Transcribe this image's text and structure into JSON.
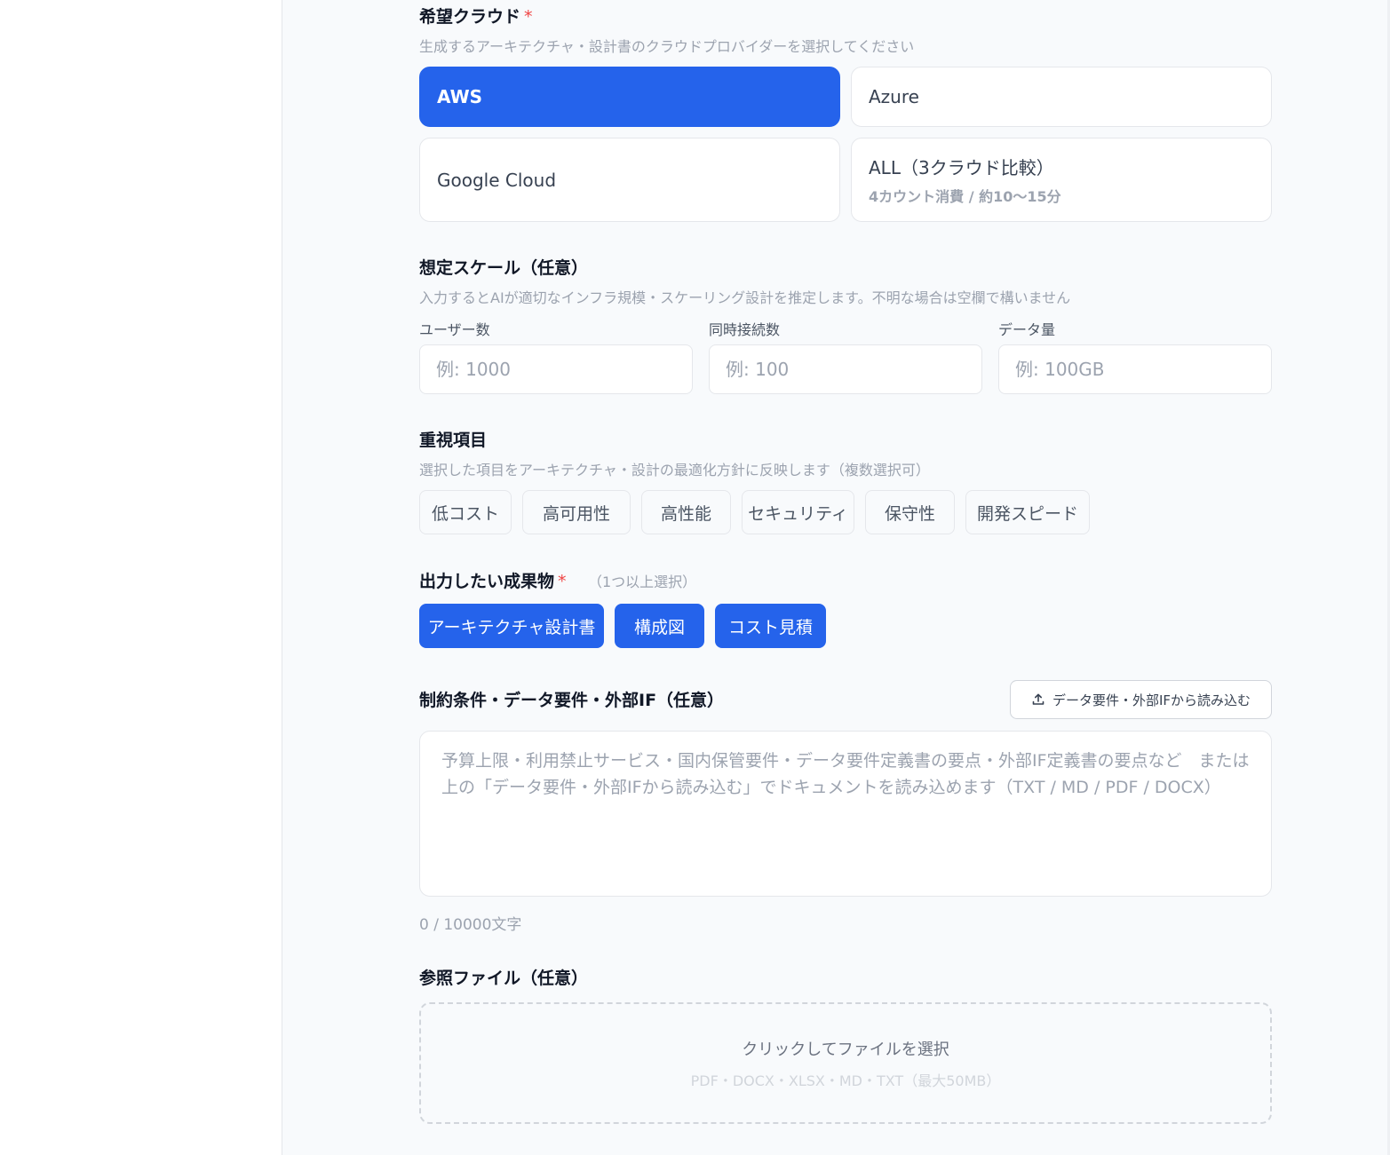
{
  "cloud": {
    "label": "希望クラウド",
    "required_mark": "*",
    "hint": "生成するアーキテクチャ・設計書のクラウドプロバイダーを選択してください",
    "options": [
      {
        "label": "AWS",
        "selected": true
      },
      {
        "label": "Azure",
        "selected": false
      },
      {
        "label": "Google Cloud",
        "selected": false
      },
      {
        "label": "ALL（3クラウド比較）",
        "sub": "4カウント消費 / 約10〜15分",
        "selected": false
      }
    ]
  },
  "scale": {
    "label": "想定スケール（任意）",
    "hint": "入力するとAIが適切なインフラ規模・スケーリング設計を推定します。不明な場合は空欄で構いません",
    "fields": [
      {
        "label": "ユーザー数",
        "placeholder": "例: 1000",
        "value": ""
      },
      {
        "label": "同時接続数",
        "placeholder": "例: 100",
        "value": ""
      },
      {
        "label": "データ量",
        "placeholder": "例: 100GB",
        "value": ""
      }
    ]
  },
  "priorities": {
    "label": "重視項目",
    "hint": "選択した項目をアーキテクチャ・設計の最適化方針に反映します（複数選択可）",
    "chips": [
      {
        "label": "低コスト",
        "selected": false
      },
      {
        "label": "高可用性",
        "selected": false
      },
      {
        "label": "高性能",
        "selected": false
      },
      {
        "label": "セキュリティ",
        "selected": false
      },
      {
        "label": "保守性",
        "selected": false
      },
      {
        "label": "開発スピード",
        "selected": false
      }
    ]
  },
  "deliverables": {
    "label": "出力したい成果物",
    "required_mark": "*",
    "hint": "（1つ以上選択）",
    "chips": [
      {
        "label": "アーキテクチャ設計書",
        "selected": true
      },
      {
        "label": "構成図",
        "selected": true
      },
      {
        "label": "コスト見積",
        "selected": true
      }
    ]
  },
  "constraints": {
    "label": "制約条件・データ要件・外部IF（任意）",
    "import_button": "データ要件・外部IFから読み込む",
    "import_icon": "upload-icon",
    "placeholder": "予算上限・利用禁止サービス・国内保管要件・データ要件定義書の要点・外部IF定義書の要点など　または上の「データ要件・外部IFから読み込む」でドキュメントを読み込めます（TXT / MD / PDF / DOCX）",
    "value": "",
    "counter": "0 / 10000文字"
  },
  "reference": {
    "label": "参照ファイル（任意）",
    "dropzone_main": "クリックしてファイルを選択",
    "dropzone_sub": "PDF・DOCX・XLSX・MD・TXT（最大50MB）"
  },
  "colors": {
    "accent": "#2563eb",
    "required": "#ef4444",
    "border": "#e5e7eb",
    "background": "#f8fafc"
  }
}
